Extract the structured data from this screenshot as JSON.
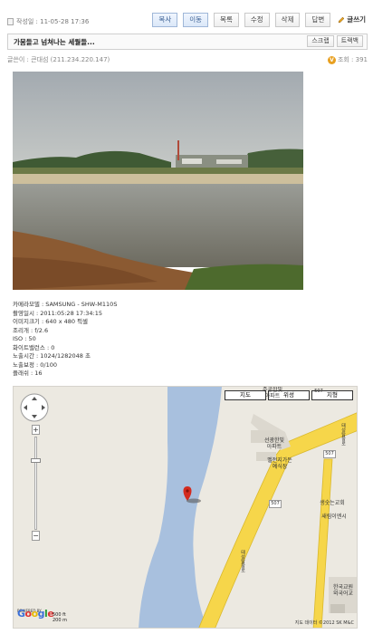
{
  "toolbar": {
    "date": "작성일 : 11-05-28 17:36",
    "buttons": [
      "복사",
      "이동",
      "목록",
      "수정",
      "삭제",
      "답변"
    ],
    "write_label": "글쓰기"
  },
  "post": {
    "title": "가뭄들고 넘쳐나는 세월들...",
    "scrap_label": "스크랩",
    "trackback_label": "트랙백",
    "author": "글쓴이 : 큰대섬 (211.234.220.147)",
    "views": "조회 : 391"
  },
  "exif": {
    "lines": [
      "카메라모델 : SAMSUNG - SHW-M110S",
      "촬영일시 : 2011:05:28 17:34:15",
      "이미지크기 : 640 x 480 픽셀",
      "조리개 : f/2.6",
      "ISO : 50",
      "화이트밸런스 : 0",
      "노출시간 : 1024/1282048 초",
      "노출보정 : 0/100",
      "플래쉬 : 16"
    ]
  },
  "map": {
    "types": [
      "지도",
      "위성",
      "지형"
    ],
    "labels": {
      "apt1": "주공한빛\n아파트",
      "apt2": "선광한빛\n아파트",
      "wedding": "벨전지가든\n예식장",
      "church": "생숫는교회",
      "newapt": "새림이엔시",
      "korea": "한국교원\n외국어교",
      "road": "507",
      "road2": "507",
      "road3": "507",
      "drive": "태성탑항로",
      "drive2": "태성탑항로"
    },
    "scale_top": "500 ft",
    "scale_bottom": "200 m",
    "powered": "POWERED BY",
    "copyright": "지도 데이터 ©2012 SK M&C"
  },
  "colors": {
    "accent": "#3a5f93",
    "road": "#f6d64a",
    "river": "#a8c0de",
    "land": "#ece9e1"
  }
}
